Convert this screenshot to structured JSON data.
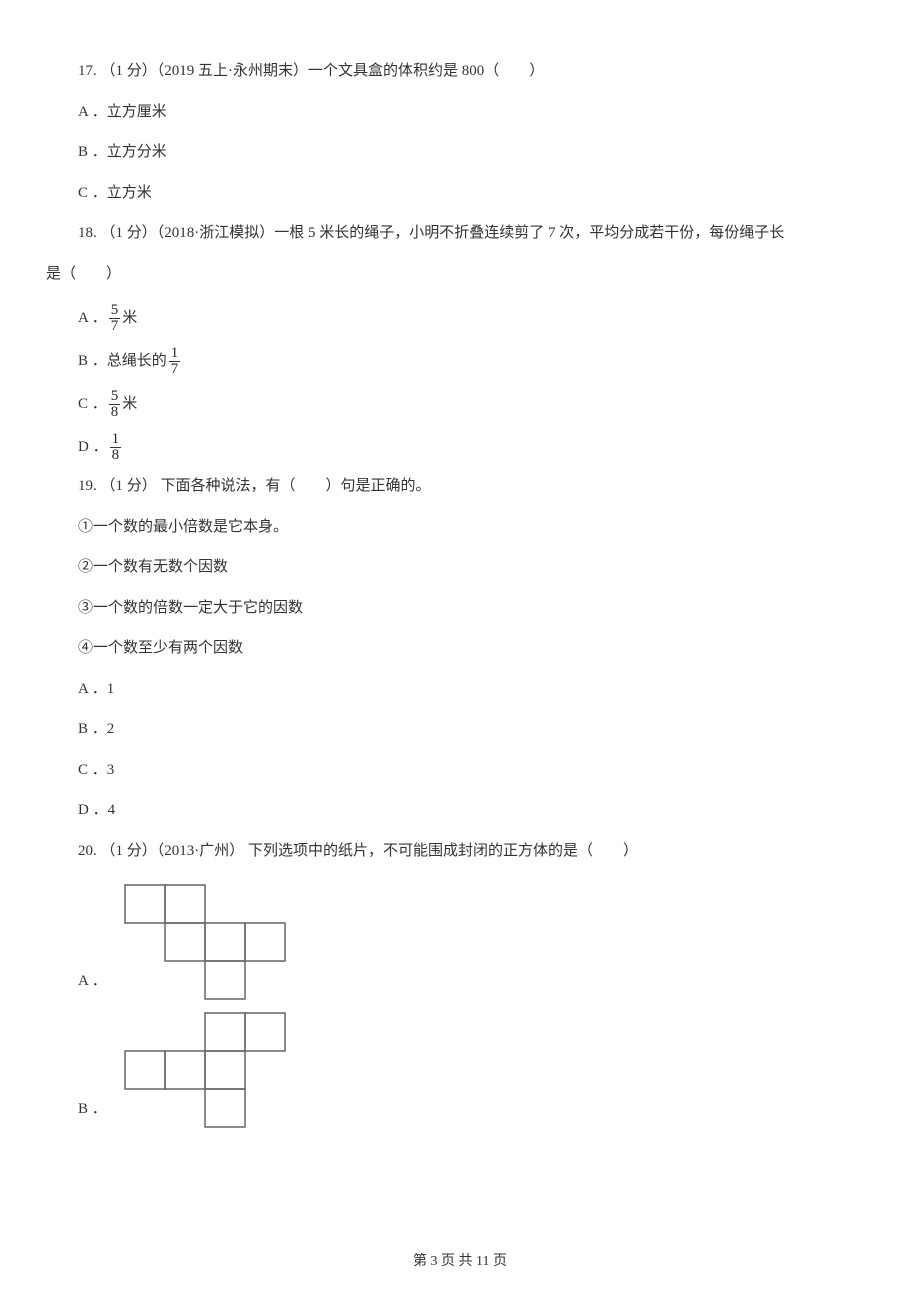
{
  "q17": {
    "stem": "17. （1 分）（2019 五上·永州期末）一个文具盒的体积约是 800（　　）",
    "options": [
      "A ．立方厘米",
      "B ．立方分米",
      "C ．立方米"
    ]
  },
  "q18": {
    "stem_a": "18. （1 分）（2018·浙江模拟）一根 5 米长的绳子，小明不折叠连续剪了 7 次，平均分成若干份，每份绳子长",
    "stem_b": "是（　　）",
    "optA_pre": "A ．",
    "optA_post": " 米",
    "optA_num": "5",
    "optA_den": "7",
    "optB_pre": "B ．总绳长的 ",
    "optB_num": "1",
    "optB_den": "7",
    "optC_pre": "C ．",
    "optC_post": " 米",
    "optC_num": "5",
    "optC_den": "8",
    "optD_pre": "D ．",
    "optD_num": "1",
    "optD_den": "8"
  },
  "q19": {
    "stem": "19. （1 分） 下面各种说法，有（　　）句是正确的。",
    "s1": "①一个数的最小倍数是它本身。",
    "s2": "②一个数有无数个因数",
    "s3": "③一个数的倍数一定大于它的因数",
    "s4": "④一个数至少有两个因数",
    "options": [
      "A ．1",
      "B ．2",
      "C ．3",
      "D ．4"
    ]
  },
  "q20": {
    "stem": "20. （1 分）（2013·广州） 下列选项中的纸片，不可能围成封闭的正方体的是（　　）",
    "optA_label": "A ．",
    "optB_label": "B ．"
  },
  "footer": "第 3 页 共 11 页"
}
